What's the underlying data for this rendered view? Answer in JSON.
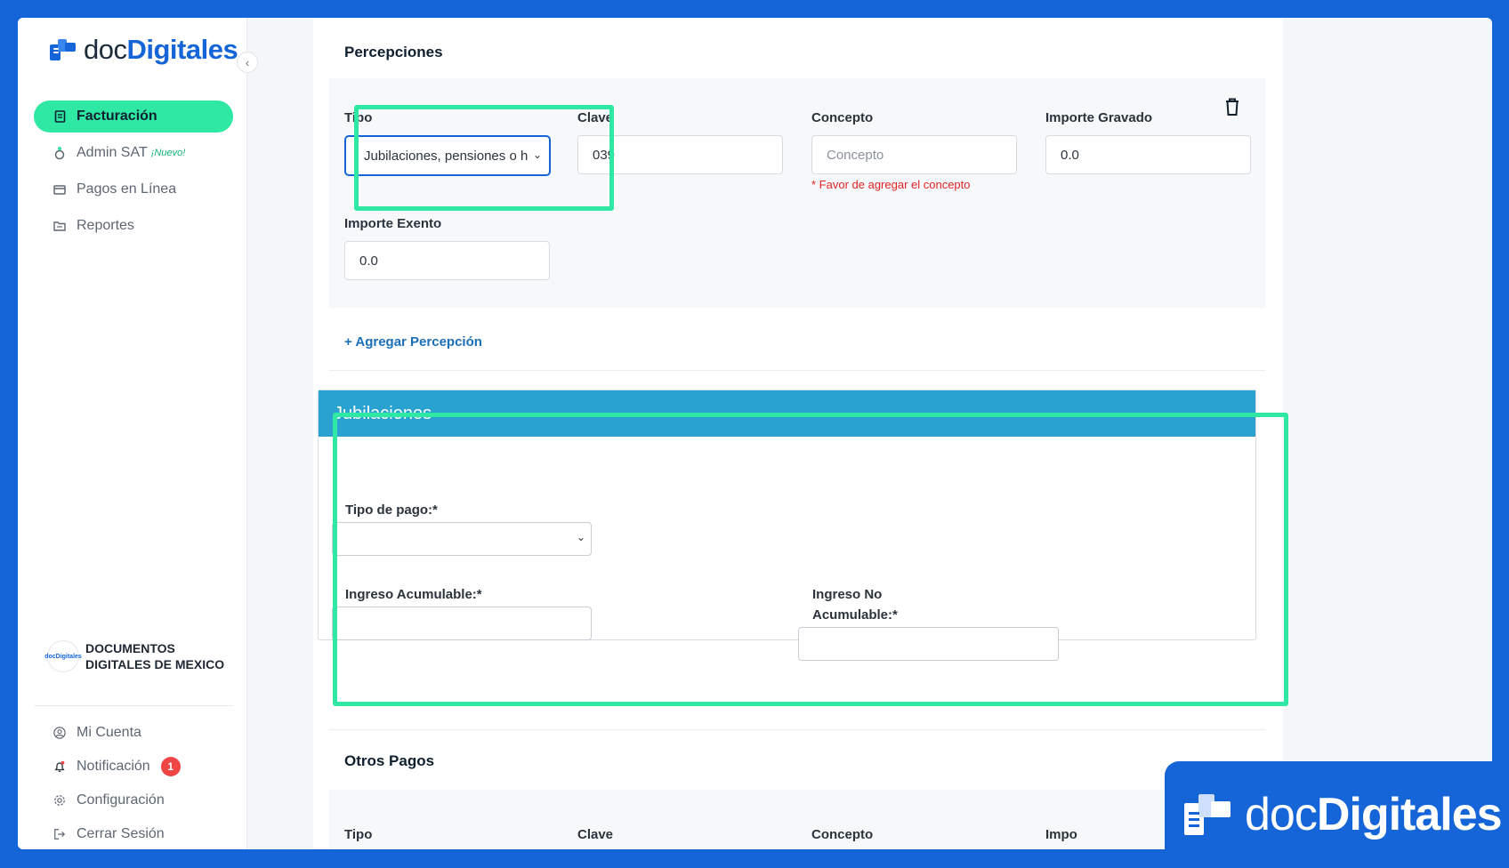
{
  "sidebar": {
    "logo": {
      "prefix": "doc",
      "bold": "Digitales"
    },
    "collapse_icon": "chevron-left-icon",
    "nav": [
      {
        "label": "Facturación",
        "icon": "invoice-icon",
        "active": true
      },
      {
        "label": "Admin SAT",
        "tag": "¡Nuevo!",
        "icon": "admin-icon"
      },
      {
        "label": "Pagos en Línea",
        "icon": "card-icon"
      },
      {
        "label": "Reportes",
        "icon": "folder-icon"
      }
    ],
    "company": {
      "name": "DOCUMENTOS DIGITALES DE MEXICO",
      "avatar_text": "docDigitales"
    },
    "bottom": [
      {
        "label": "Mi Cuenta",
        "icon": "user-circle-icon"
      },
      {
        "label": "Notificación",
        "icon": "bell-icon",
        "badge": "1"
      },
      {
        "label": "Configuración",
        "icon": "gear-icon"
      },
      {
        "label": "Cerrar Sesión",
        "icon": "logout-icon"
      }
    ]
  },
  "percepciones": {
    "title": "Percepciones",
    "tipo_label": "Tipo",
    "tipo_value": "Jubilaciones, pensiones o h",
    "clave_label": "Clave",
    "clave_value": "039",
    "concepto_label": "Concepto",
    "concepto_placeholder": "Concepto",
    "concepto_error": "* Favor de agregar el concepto",
    "gravado_label": "Importe Gravado",
    "gravado_value": "0.0",
    "exento_label": "Importe Exento",
    "exento_value": "0.0",
    "add_link": "+ Agregar Percepción"
  },
  "jubilaciones": {
    "title": "Jubilaciones",
    "tipo_pago_label": "Tipo de pago:*",
    "ingreso_acumulable_label": "Ingreso Acumulable:*",
    "ingreso_no_acumulable_label_1": "Ingreso No",
    "ingreso_no_acumulable_label_2": "Acumulable:*"
  },
  "otros_pagos": {
    "title": "Otros Pagos",
    "tipo_label": "Tipo",
    "clave_label": "Clave",
    "concepto_label": "Concepto",
    "importe_label": "Impo"
  },
  "brand_overlay": {
    "prefix": "doc",
    "bold": "Digitales"
  },
  "colors": {
    "primary": "#1565d8",
    "accent": "#2ee8a3",
    "panel_header": "#2aa2d1",
    "error": "#e02424"
  }
}
